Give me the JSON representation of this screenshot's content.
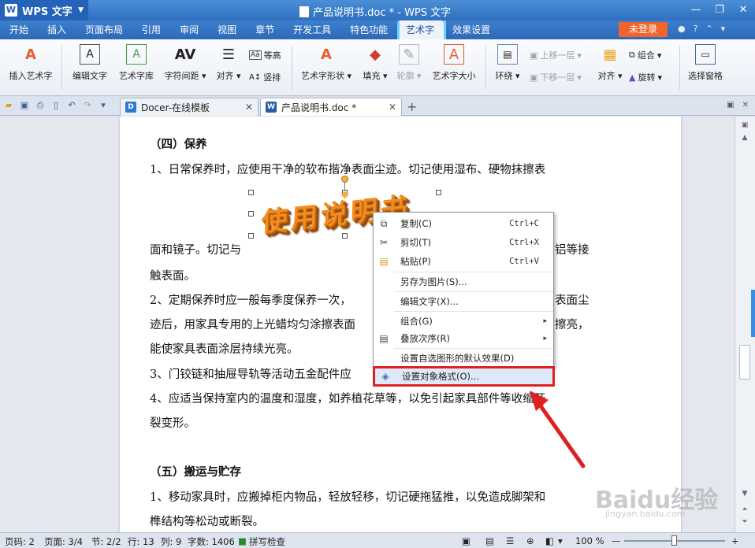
{
  "titlebar": {
    "app_name": "WPS 文字",
    "document_title": "产品说明书.doc * - WPS 文字"
  },
  "menubar": {
    "tabs": [
      "开始",
      "插入",
      "页面布局",
      "引用",
      "审阅",
      "视图",
      "章节",
      "开发工具",
      "特色功能",
      "艺术字",
      "效果设置"
    ],
    "active": "艺术字",
    "login": "未登录"
  },
  "ribbon": {
    "insert_art": "插入艺术字",
    "edit_text": "编辑文字",
    "art_library": "艺术字库",
    "char_spacing": "字符间距",
    "align": "对齐",
    "equal_height": "等高",
    "vertical": "竖排",
    "shape": "艺术字形状",
    "fill": "填充",
    "outline": "轮廓",
    "art_size": "艺术字大小",
    "wrap": "环绕",
    "bring_forward": "上移一层",
    "send_backward": "下移一层",
    "align2": "对齐",
    "group": "组合",
    "rotate": "旋转",
    "select_pane": "选择窗格"
  },
  "tabs": [
    {
      "label": "Docer-在线模板"
    },
    {
      "label": "产品说明书.doc *"
    }
  ],
  "document": {
    "lines": [
      "（四）保养",
      "1、日常保养时，应使用干净的软布揩净表面尘迹。切记使用湿布、硬物抹擦表",
      "面和镜子。切记与",
      "铝等接",
      "触表面。",
      "2、定期保养时应一般每季度保养一次，",
      "表面尘",
      "迹后，用家具专用的上光蜡均匀涂擦表面",
      "擦亮，",
      "能使家具表面涂层持续光亮。",
      "3、门铰链和抽屉导轨等活动五金配件应",
      "4、应适当保持室内的温度和湿度，如养植花草等，以免引起家具部件等收缩开",
      "裂变形。",
      "（五）搬运与贮存",
      "1、移动家具时，应搬掉柜内物品，轻放轻移，切记硬拖猛推，以免造成脚架和",
      "榫结构等松动或断裂。"
    ],
    "wordart": "使用说明书"
  },
  "context_menu": {
    "items": [
      {
        "label": "复制(C)",
        "shortcut": "Ctrl+C",
        "icon": "copy-icon"
      },
      {
        "label": "剪切(T)",
        "shortcut": "Ctrl+X",
        "icon": "cut-icon"
      },
      {
        "label": "粘贴(P)",
        "shortcut": "Ctrl+V",
        "icon": "paste-icon"
      },
      {
        "label": "另存为图片(S)..."
      },
      {
        "label": "编辑文字(X)..."
      },
      {
        "label": "组合(G)",
        "submenu": true
      },
      {
        "label": "叠放次序(R)",
        "submenu": true,
        "icon": "order-icon"
      },
      {
        "label": "设置自选图形的默认效果(D)"
      },
      {
        "label": "设置对象格式(O)...",
        "icon": "format-icon",
        "highlighted": true
      }
    ]
  },
  "statusbar": {
    "page_no": "页码: 2",
    "pages": "页面: 3/4",
    "section": "节: 2/2",
    "row": "行: 13",
    "col": "列: 9",
    "words": "字数: 1406",
    "spell": "拼写检查",
    "zoom": "100 %"
  },
  "watermark": {
    "text": "Baidu经验",
    "sub": "jingyan.baidu.com"
  }
}
